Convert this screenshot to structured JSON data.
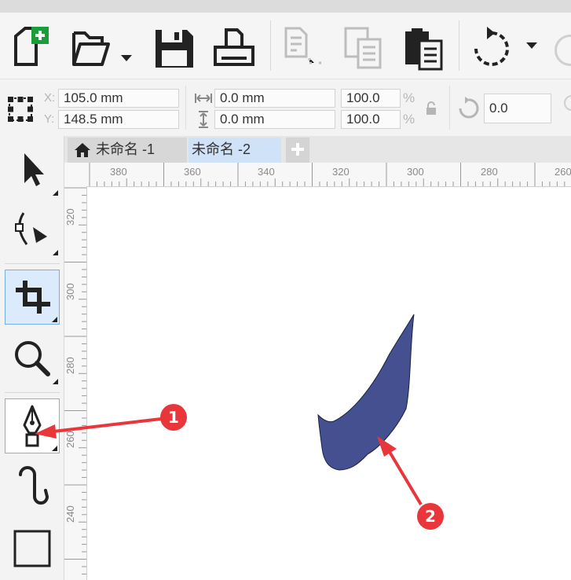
{
  "toolbar": {
    "buttons": [
      {
        "name": "new-document",
        "icon": "new-document-icon"
      },
      {
        "name": "open",
        "icon": "folder-open-icon"
      },
      {
        "name": "save",
        "icon": "floppy-disk-icon"
      },
      {
        "name": "print",
        "icon": "printer-icon"
      },
      {
        "name": "cut",
        "icon": "cut-icon",
        "disabled": true
      },
      {
        "name": "copy",
        "icon": "copy-icon",
        "disabled": true
      },
      {
        "name": "paste",
        "icon": "paste-icon"
      },
      {
        "name": "undo",
        "icon": "undo-icon"
      }
    ],
    "accent_color": "#1a9c3a"
  },
  "property_bar": {
    "x_label": "X:",
    "y_label": "Y:",
    "x_value": "105.0 mm",
    "y_value": "148.5 mm",
    "width_value": "0.0 mm",
    "height_value": "0.0 mm",
    "scale_x": "100.0",
    "scale_y": "100.0",
    "percent": "%",
    "rotation": "0.0"
  },
  "tabs": [
    {
      "label": "未命名 -1",
      "active": false
    },
    {
      "label": "未命名 -2",
      "active": true
    }
  ],
  "ruler": {
    "horizontal_labels": [
      "380",
      "360",
      "340",
      "320",
      "300",
      "280",
      "260"
    ],
    "vertical_labels": [
      "320",
      "300",
      "280",
      "260",
      "240"
    ]
  },
  "toolbox": {
    "tools": [
      {
        "name": "pick-tool",
        "icon": "arrow-pointer-icon"
      },
      {
        "name": "shape-tool",
        "icon": "shape-edit-icon"
      },
      {
        "name": "crop-tool",
        "icon": "crop-icon",
        "selected": true
      },
      {
        "name": "zoom-tool",
        "icon": "magnifier-icon"
      },
      {
        "name": "pen-tool",
        "icon": "pen-nib-icon",
        "active": true
      },
      {
        "name": "artistic-media-tool",
        "icon": "artistic-media-icon"
      },
      {
        "name": "rectangle-tool",
        "icon": "rectangle-icon"
      }
    ]
  },
  "annotations": [
    {
      "number": "1",
      "color": "#e8363a"
    },
    {
      "number": "2",
      "color": "#e8363a"
    }
  ],
  "shape": {
    "fill": "#44508f"
  }
}
